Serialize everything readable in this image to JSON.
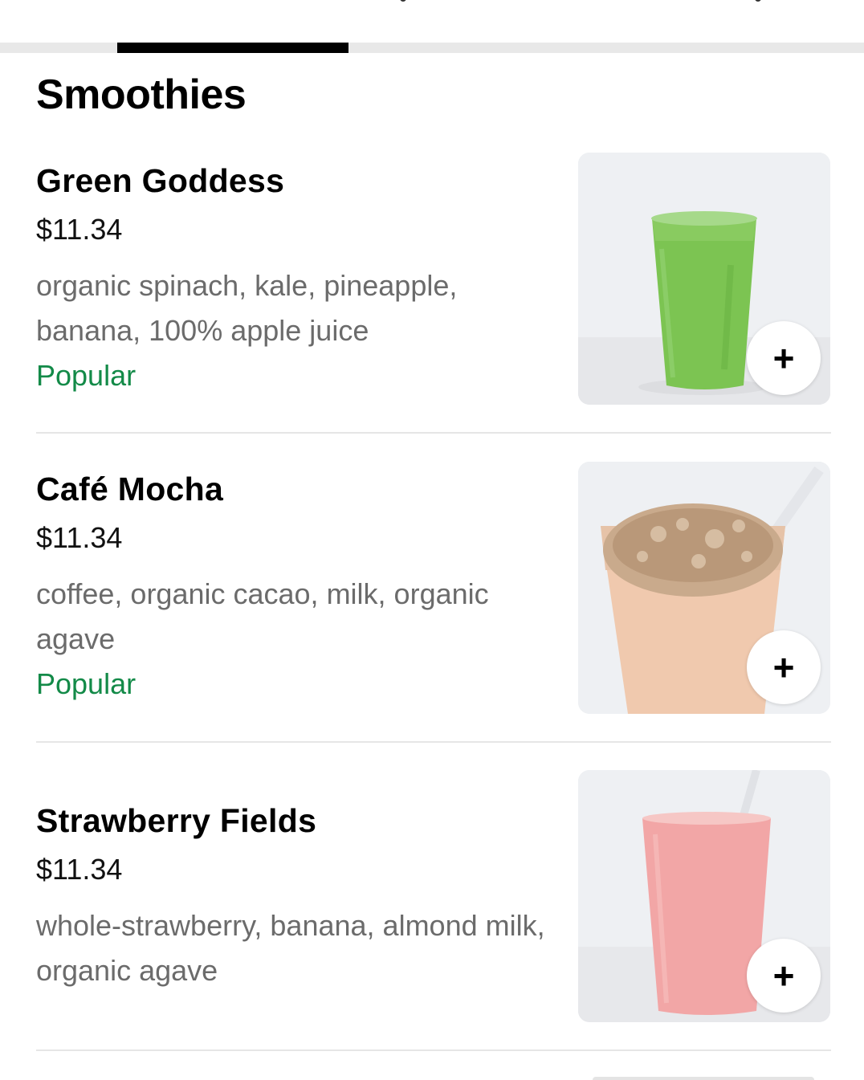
{
  "section": {
    "title": "Smoothies"
  },
  "colors": {
    "popular": "#138a48",
    "description": "#6b6b6b",
    "tab_indicator": "#000000"
  },
  "items": [
    {
      "name": "Green Goddess",
      "price": "$11.34",
      "description": "organic spinach, kale, pineapple, banana, 100% apple juice",
      "badge": "Popular",
      "add_icon": "plus-icon",
      "image": "green-smoothie-cup"
    },
    {
      "name": "Café Mocha",
      "price": "$11.34",
      "description": "coffee, organic cacao, milk, organic agave",
      "badge": "Popular",
      "add_icon": "plus-icon",
      "image": "mocha-smoothie-cup"
    },
    {
      "name": "Strawberry Fields",
      "price": "$11.34",
      "description": "whole-strawberry, banana, almond milk, organic agave",
      "badge": "",
      "add_icon": "plus-icon",
      "image": "strawberry-smoothie-cup"
    }
  ],
  "add_button_symbol": "+"
}
